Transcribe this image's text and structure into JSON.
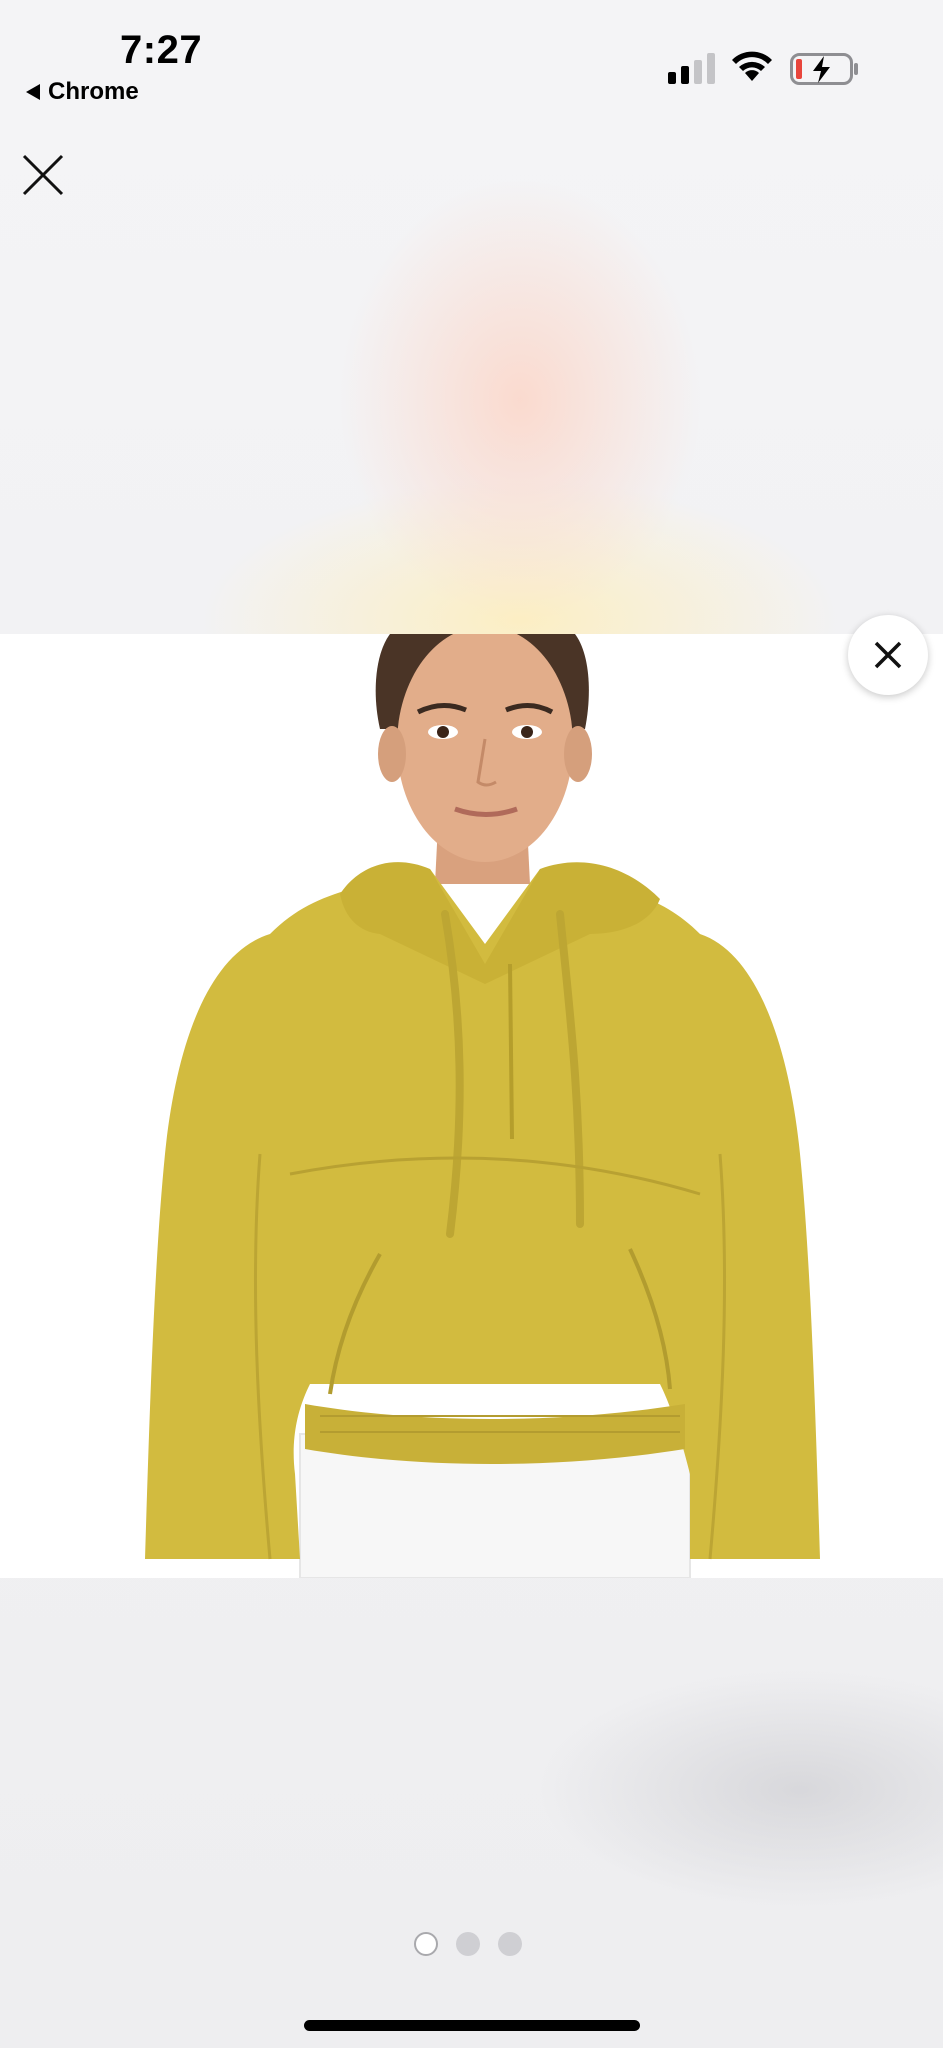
{
  "status_bar": {
    "time": "7:27",
    "back_app": "Chrome",
    "signal_bars_active": 2,
    "battery_state": "low-charging"
  },
  "icons": {
    "close_top": "close-icon",
    "close_photo": "close-icon",
    "wifi": "wifi-icon",
    "battery": "battery-charging-icon",
    "back": "back-arrow-icon"
  },
  "gallery": {
    "total_images": 3,
    "current_index": 1,
    "product_color": "#d2bb3f"
  },
  "colors": {
    "battery_low": "#e8453c",
    "dot_inactive": "#cfcfd3"
  }
}
